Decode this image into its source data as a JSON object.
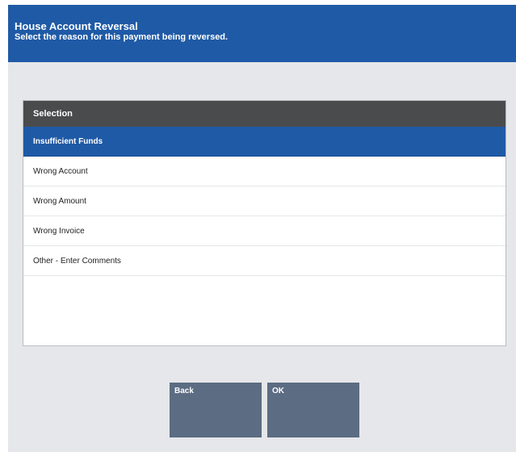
{
  "header": {
    "title": "House Account Reversal",
    "subtitle": "Select the reason for this payment being reversed."
  },
  "list": {
    "column_header": "Selection",
    "items": [
      {
        "label": "Insufficient Funds",
        "selected": true
      },
      {
        "label": "Wrong Account",
        "selected": false
      },
      {
        "label": "Wrong Amount",
        "selected": false
      },
      {
        "label": "Wrong Invoice",
        "selected": false
      },
      {
        "label": "Other - Enter Comments",
        "selected": false
      }
    ]
  },
  "buttons": {
    "back_label": "Back",
    "ok_label": "OK"
  },
  "colors": {
    "header_bg": "#1f5aa6",
    "selected_row": "#1f5aa6",
    "list_header_bg": "#4a4b4d",
    "button_bg": "#5c6c82",
    "screen_bg": "#e6e7ea"
  }
}
